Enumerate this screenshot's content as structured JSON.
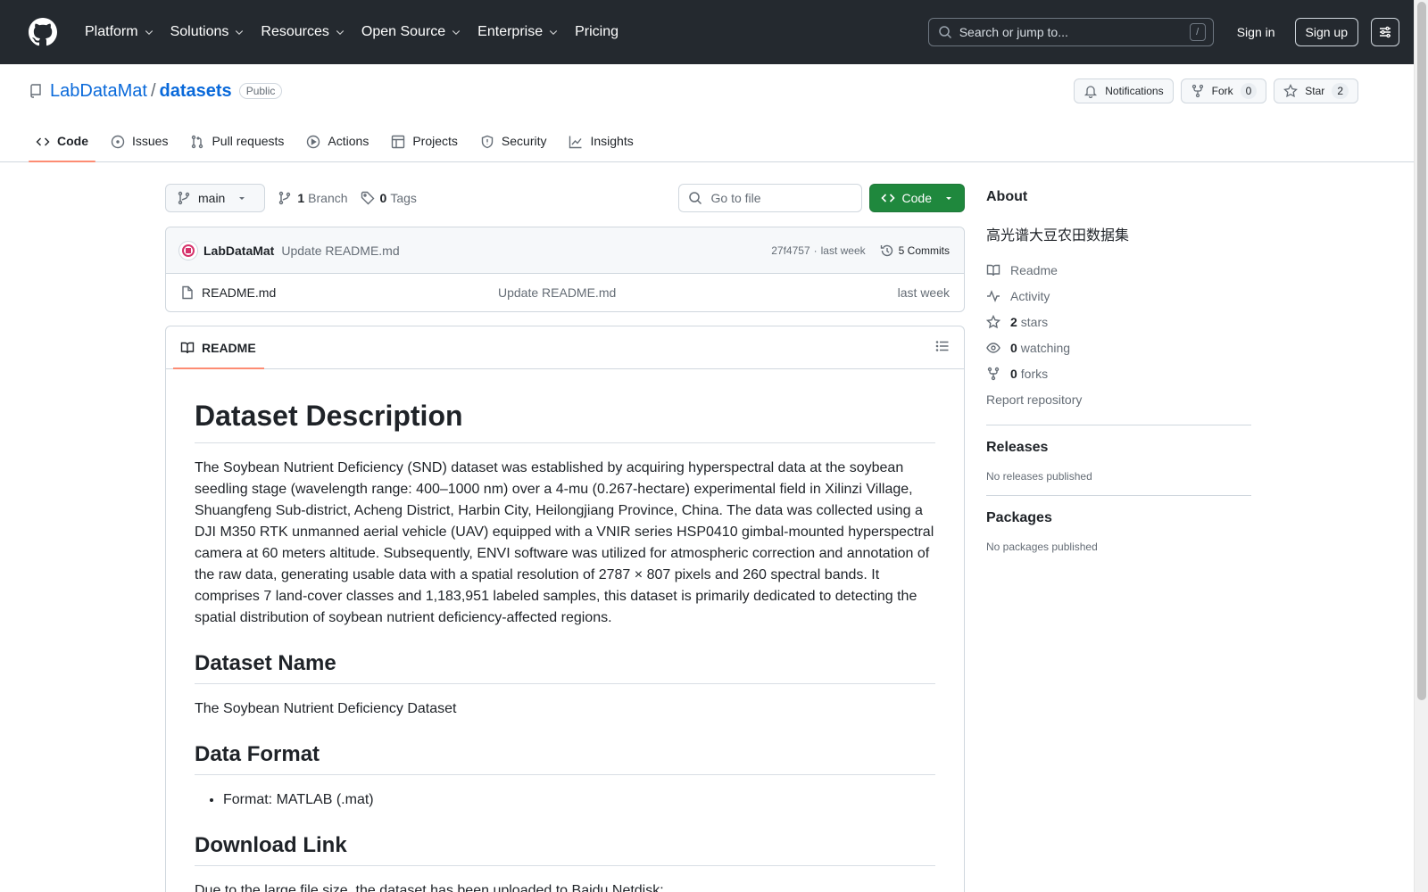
{
  "header": {
    "nav": [
      "Platform",
      "Solutions",
      "Resources",
      "Open Source",
      "Enterprise",
      "Pricing"
    ],
    "search_placeholder": "Search or jump to...",
    "search_key": "/",
    "sign_in": "Sign in",
    "sign_up": "Sign up"
  },
  "repo": {
    "owner": "LabDataMat",
    "separator": "/",
    "name": "datasets",
    "visibility": "Public",
    "notifications_label": "Notifications",
    "fork_label": "Fork",
    "fork_count": "0",
    "star_label": "Star",
    "star_count": "2"
  },
  "tabs": [
    "Code",
    "Issues",
    "Pull requests",
    "Actions",
    "Projects",
    "Security",
    "Insights"
  ],
  "branchbar": {
    "branch": "main",
    "branches_count": "1",
    "branches_label": "Branch",
    "tags_count": "0",
    "tags_label": "Tags",
    "goto_placeholder": "Go to file",
    "code_label": "Code"
  },
  "commit": {
    "author": "LabDataMat",
    "message": "Update README.md",
    "sha": "27f4757",
    "dot": "·",
    "time": "last week",
    "commits_label": "5 Commits"
  },
  "files": [
    {
      "name": "README.md",
      "message": "Update README.md",
      "time": "last week"
    }
  ],
  "readme": {
    "tab_label": "README",
    "h1": "Dataset Description",
    "p1": "The Soybean Nutrient Deficiency (SND) dataset was established by acquiring hyperspectral data at the soybean seedling stage (wavelength range: 400–1000 nm) over a 4-mu (0.267-hectare) experimental field in Xilinzi Village, Shuangfeng Sub-district, Acheng District, Harbin City, Heilongjiang Province, China. The data was collected using a DJI M350 RTK unmanned aerial vehicle (UAV) equipped with a VNIR series HSP0410 gimbal-mounted hyperspectral camera at 60 meters altitude. Subsequently, ENVI software was utilized for atmospheric correction and annotation of the raw data, generating usable data with a spatial resolution of 2787 × 807 pixels and 260 spectral bands. It comprises 7 land-cover classes and 1,183,951 labeled samples, this dataset is primarily dedicated to detecting the spatial distribution of soybean nutrient deficiency-affected regions.",
    "h2_name": "Dataset Name",
    "p_name": "The Soybean Nutrient Deficiency Dataset",
    "h2_format": "Data Format",
    "format_item": "Format: MATLAB (.mat)",
    "h2_download": "Download Link",
    "p_download": "Due to the large file size, the dataset has been uploaded to Baidu Netdisk:"
  },
  "about": {
    "title": "About",
    "description": "高光谱大豆农田数据集",
    "readme": "Readme",
    "activity": "Activity",
    "stars_count": "2",
    "stars_label": "stars",
    "watching_count": "0",
    "watching_label": "watching",
    "forks_count": "0",
    "forks_label": "forks",
    "report": "Report repository"
  },
  "releases": {
    "title": "Releases",
    "note": "No releases published"
  },
  "packages": {
    "title": "Packages",
    "note": "No packages published"
  }
}
